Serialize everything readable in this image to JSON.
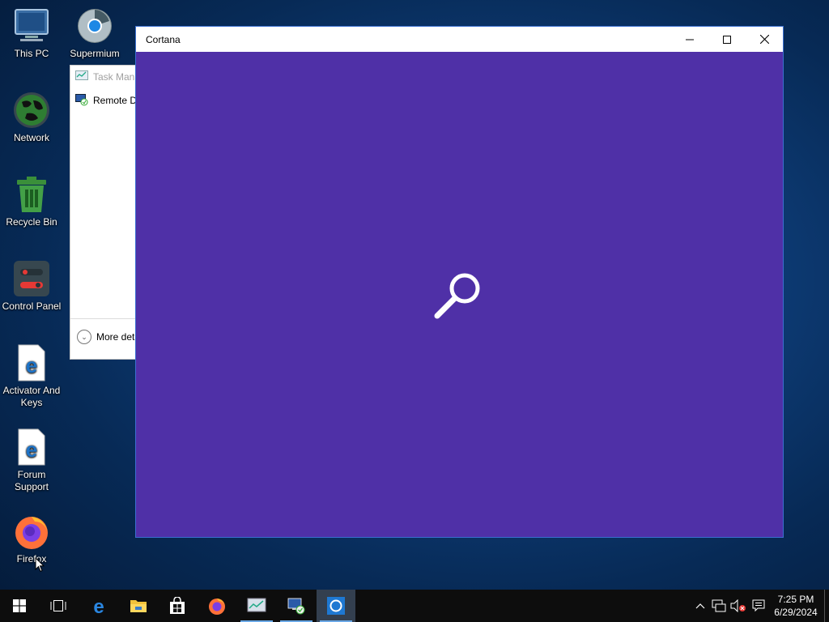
{
  "desktop_icons": [
    {
      "label": "This PC",
      "icon": "this-pc-icon"
    },
    {
      "label": "Supermium",
      "icon": "supermium-icon"
    },
    {
      "label": "Network",
      "icon": "network-icon"
    },
    {
      "label": "Recycle Bin",
      "icon": "recycle-bin-icon"
    },
    {
      "label": "Control Panel",
      "icon": "control-panel-icon"
    },
    {
      "label": "Activator And Keys",
      "icon": "edge-document-icon"
    },
    {
      "label": "Forum Support",
      "icon": "edge-document-icon"
    },
    {
      "label": "Firefox",
      "icon": "firefox-icon"
    }
  ],
  "task_manager": {
    "items": [
      {
        "label": "Task Mana",
        "icon": "task-manager-icon"
      },
      {
        "label": "Remote D",
        "icon": "remote-desktop-icon"
      }
    ],
    "more_details": "More det"
  },
  "cortana_window": {
    "title": "Cortana",
    "minimize": "minimize-icon",
    "maximize": "maximize-icon",
    "close": "close-icon",
    "center_icon": "search-icon",
    "background_color": "#4f30a7"
  },
  "taskbar": {
    "buttons": [
      {
        "name": "start-button",
        "icon": "windows-logo-icon"
      },
      {
        "name": "task-view-button",
        "icon": "task-view-icon"
      },
      {
        "name": "edge-taskbar-button",
        "icon": "edge-icon"
      },
      {
        "name": "file-explorer-taskbar-button",
        "icon": "folder-icon"
      },
      {
        "name": "store-taskbar-button",
        "icon": "store-icon"
      },
      {
        "name": "firefox-taskbar-button",
        "icon": "firefox-icon"
      },
      {
        "name": "task-manager-taskbar-button",
        "icon": "task-manager-icon"
      },
      {
        "name": "remote-desktop-taskbar-button",
        "icon": "remote-desktop-icon"
      },
      {
        "name": "cortana-taskbar-button",
        "icon": "cortana-icon"
      }
    ],
    "tray": {
      "icons": [
        "chevron-up-icon",
        "network-icon",
        "volume-muted-icon",
        "notification-icon"
      ]
    },
    "clock": {
      "time": "7:25 PM",
      "date": "6/29/2024"
    }
  }
}
